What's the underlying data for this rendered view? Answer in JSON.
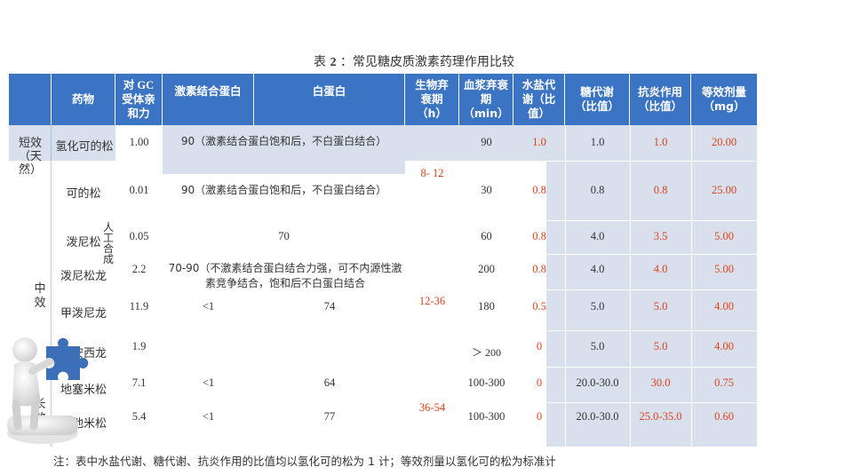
{
  "caption": {
    "prefix": "表",
    "num": "2",
    "text": "：常见糖皮质激素药理作用比较"
  },
  "headers": {
    "group": "",
    "drug": "药物",
    "gc": "对 GC 受体亲和力",
    "cbg": "激素结合蛋白",
    "albumin": "白蛋白",
    "bio_halflife": "生物弃衰期（h）",
    "plasma_halflife": "血浆弃衰期（min）",
    "salt": "水盐代谢（比值）",
    "sugar": "糖代谢（比值）",
    "anti": "抗炎作用（比值）",
    "equiv": "等效剂量（mg）"
  },
  "groups": {
    "short": "短效（天然）",
    "medium": "中效",
    "long": "长效",
    "synthetic": "人工合成"
  },
  "rows": [
    {
      "drug": "氢化可的松",
      "gc": "1.00",
      "binding": "90（激素结合蛋白饱和后，不白蛋白结合）",
      "plasma": "90",
      "salt": "1.0",
      "sugar": "1.0",
      "anti": "1.0",
      "equiv": "20.00"
    },
    {
      "drug": "可的松",
      "gc": "0.01",
      "binding": "90（激素结合蛋白饱和后，不白蛋白结合）",
      "plasma": "30",
      "salt": "0.8",
      "sugar": "0.8",
      "anti": "0.8",
      "equiv": "25.00"
    },
    {
      "drug": "泼尼松",
      "gc": "0.05",
      "binding": "70",
      "plasma": "60",
      "salt": "0.8",
      "sugar": "4.0",
      "anti": "3.5",
      "equiv": "5.00"
    },
    {
      "drug": "泼尼松龙",
      "gc": "2.2",
      "binding": "70-90（不激素结合蛋白结合力强，可不内源性激素竞争结合，饱和后不白蛋白结合",
      "plasma": "200",
      "salt": "0.8",
      "sugar": "4.0",
      "anti": "4.0",
      "equiv": "5.00"
    },
    {
      "drug": "甲泼尼龙",
      "gc": "11.9",
      "cbg": "<1",
      "albumin": "74",
      "plasma": "180",
      "salt": "0.5",
      "sugar": "5.0",
      "anti": "5.0",
      "equiv": "4.00"
    },
    {
      "drug": "曲安西龙",
      "gc": "1.9",
      "plasma": "＞ 200",
      "salt": "0",
      "sugar": "5.0",
      "anti": "5.0",
      "equiv": "4.00"
    },
    {
      "drug": "地塞米松",
      "gc": "7.1",
      "cbg": "<1",
      "albumin": "64",
      "plasma": "100-300",
      "salt": "0",
      "sugar": "20.0-30.0",
      "anti": "30.0",
      "equiv": "0.75"
    },
    {
      "drug": "倍他米松",
      "gc": "5.4",
      "cbg": "<1",
      "albumin": "77",
      "plasma": "100-300",
      "salt": "0",
      "sugar": "20.0-30.0",
      "anti": "25.0-35.0",
      "equiv": "0.60"
    }
  ],
  "bio_halflife_values": [
    "8- 12",
    "12-36",
    "36-54"
  ],
  "footnote": "注：表中水盐代谢、糖代谢、抗炎作用的比值均以氢化可的松为 1 计；等效剂量以氢化可的松为标准计",
  "colors": {
    "header": "#3b74c2",
    "band": "#d7e0ec",
    "red": "#e0401a"
  }
}
